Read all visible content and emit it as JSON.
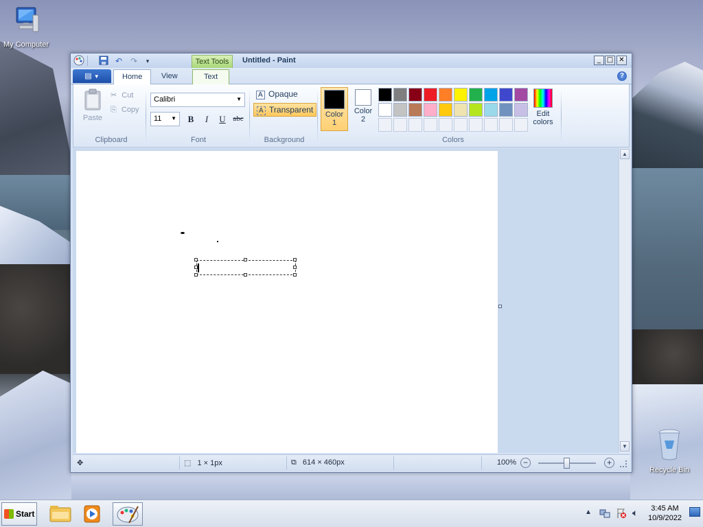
{
  "desktop": {
    "icons": [
      {
        "label": "My Computer"
      },
      {
        "label": "Recycle Bin"
      }
    ]
  },
  "window": {
    "title": "Untitled - Paint",
    "contextual_tab": "Text Tools",
    "tabs": [
      {
        "label": "Home"
      },
      {
        "label": "View"
      },
      {
        "label": "Text"
      }
    ],
    "help": "?"
  },
  "ribbon": {
    "clipboard": {
      "paste": "Paste",
      "cut": "Cut",
      "copy": "Copy",
      "label": "Clipboard"
    },
    "font": {
      "family": "Calibri",
      "size": "11",
      "bold": "B",
      "italic": "I",
      "underline": "U",
      "strike": "abc",
      "label": "Font"
    },
    "background": {
      "opaque": "Opaque",
      "transparent": "Transparent",
      "selected": "Transparent",
      "label": "Background"
    },
    "colors": {
      "color1_label": "Color",
      "color1_num": "1",
      "color1_value": "#000000",
      "color2_label": "Color",
      "color2_num": "2",
      "color2_value": "#ffffff",
      "edit_label": "Edit",
      "edit_label2": "colors",
      "label": "Colors",
      "palette_row1": [
        "#000000",
        "#7f7f7f",
        "#880015",
        "#ed1c24",
        "#ff7f27",
        "#fff200",
        "#22b14c",
        "#00a2e8",
        "#3f48cc",
        "#a349a4"
      ],
      "palette_row2": [
        "#ffffff",
        "#c3c3c3",
        "#b97a57",
        "#ffaec9",
        "#ffc90e",
        "#efe4b0",
        "#b5e61d",
        "#99d9ea",
        "#7092be",
        "#c8bfe7"
      ]
    }
  },
  "statusbar": {
    "selection_size": "1 × 1px",
    "image_size": "614 × 460px",
    "zoom": "100%"
  },
  "taskbar": {
    "start": "Start",
    "time": "3:45 AM",
    "date": "10/9/2022"
  }
}
